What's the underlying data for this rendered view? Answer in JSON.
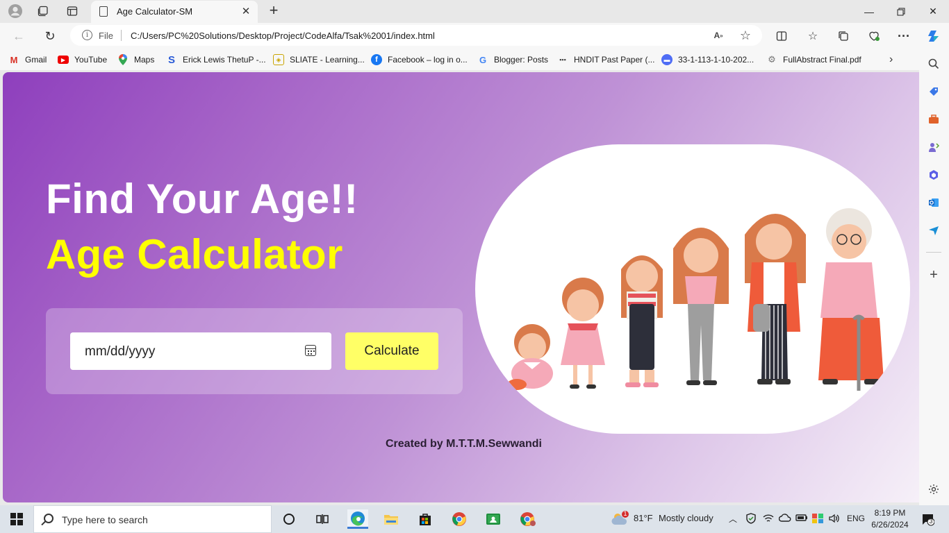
{
  "browser": {
    "tab_title": "Age Calculator-SM",
    "url_scheme": "File",
    "url": "C:/Users/PC%20Solutions/Desktop/Project/CodeAlfa/Tsak%2001/index.html"
  },
  "bookmarks": [
    {
      "label": "Gmail",
      "icon": "gmail-icon"
    },
    {
      "label": "YouTube",
      "icon": "youtube-icon"
    },
    {
      "label": "Maps",
      "icon": "maps-icon"
    },
    {
      "label": "Erick Lewis ThetuP -...",
      "icon": "s-icon"
    },
    {
      "label": "SLIATE - Learning...",
      "icon": "sliate-icon"
    },
    {
      "label": "Facebook – log in o...",
      "icon": "facebook-icon"
    },
    {
      "label": "Blogger: Posts",
      "icon": "google-icon"
    },
    {
      "label": "HNDIT Past Paper (...",
      "icon": "dots-icon"
    },
    {
      "label": "33-1-113-1-10-202...",
      "icon": "doc-icon"
    },
    {
      "label": "FullAbstract Final.pdf",
      "icon": "pdf-icon"
    }
  ],
  "page": {
    "heading": "Find Your Age!!",
    "subheading": "Age Calculator",
    "date_placeholder": "mm/dd/yyyy",
    "button_label": "Calculate",
    "footer": "Created by M.T.T.M.Sewwandi"
  },
  "taskbar": {
    "search_placeholder": "Type here to search",
    "weather_temp": "81°F",
    "weather_desc": "Mostly cloudy",
    "weather_badge": "1",
    "language": "ENG",
    "time": "8:19 PM",
    "date": "6/26/2024",
    "notification_count": "3"
  },
  "colors": {
    "heading": "#ffffff",
    "subheading": "#ffff00",
    "button": "#ffff66",
    "gradient_start": "#8e3fbd",
    "gradient_end": "#f6f0f8"
  }
}
